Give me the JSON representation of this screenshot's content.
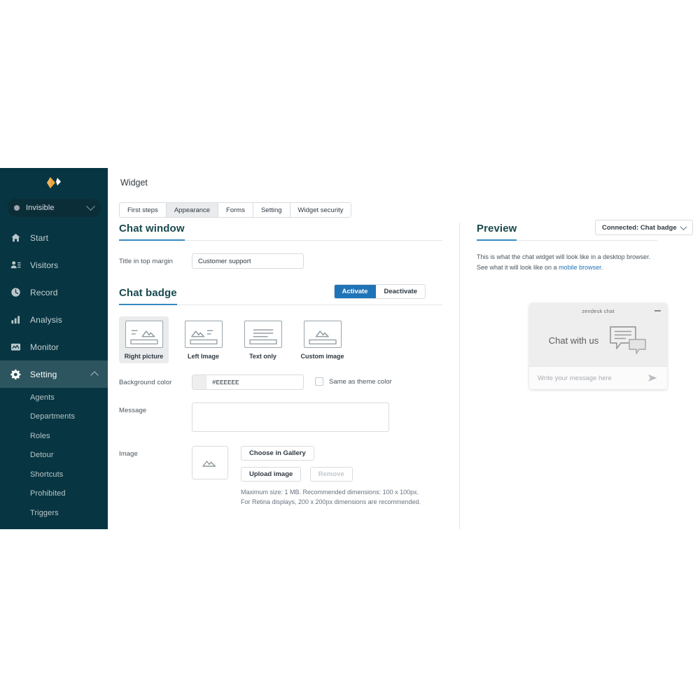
{
  "sidebar": {
    "logo_icon": "diamond-logo-icon",
    "status": {
      "label": "Invisible",
      "icon": "status-dot-icon",
      "chevron": "chevron-down-icon"
    },
    "items": [
      {
        "label": "Start",
        "icon": "home-icon",
        "active": false
      },
      {
        "label": "Visitors",
        "icon": "visitors-icon",
        "active": false
      },
      {
        "label": "Record",
        "icon": "clock-icon",
        "active": false
      },
      {
        "label": "Analysis",
        "icon": "bar-chart-icon",
        "active": false
      },
      {
        "label": "Monitor",
        "icon": "monitor-icon",
        "active": false
      },
      {
        "label": "Setting",
        "icon": "gear-icon",
        "active": true
      }
    ],
    "sub_items": [
      {
        "label": "Agents"
      },
      {
        "label": "Departments"
      },
      {
        "label": "Roles"
      },
      {
        "label": "Detour"
      },
      {
        "label": "Shortcuts"
      },
      {
        "label": "Prohibited"
      },
      {
        "label": "Triggers"
      }
    ]
  },
  "header": {
    "title": "Widget"
  },
  "tabs": [
    {
      "label": "First steps",
      "selected": false
    },
    {
      "label": "Appearance",
      "selected": true
    },
    {
      "label": "Forms",
      "selected": false
    },
    {
      "label": "Setting",
      "selected": false
    },
    {
      "label": "Widget security",
      "selected": false
    }
  ],
  "chat_window": {
    "section_title": "Chat window",
    "title_field": {
      "label": "Title in top margin",
      "value": "Customer support"
    }
  },
  "chat_badge": {
    "section_title": "Chat badge",
    "activate_label": "Activate",
    "deactivate_label": "Deactivate",
    "layouts": [
      {
        "label": "Right picture",
        "icon": "layout-right-picture-icon",
        "selected": true
      },
      {
        "label": "Left Image",
        "icon": "layout-left-image-icon",
        "selected": false
      },
      {
        "label": "Text only",
        "icon": "layout-text-only-icon",
        "selected": false
      },
      {
        "label": "Custom image",
        "icon": "layout-custom-image-icon",
        "selected": false
      }
    ],
    "background_color": {
      "label": "Background color",
      "value": "#EEEEEE",
      "swatch_hex": "#EEEEEE",
      "checkbox_label": "Same as theme color",
      "checkbox_checked": false
    },
    "message": {
      "label": "Message",
      "value": "",
      "placeholder": ""
    },
    "image": {
      "label": "Image",
      "thumb_icon": "image-placeholder-icon",
      "choose_label": "Choose in Gallery",
      "upload_label": "Upload image",
      "remove_label": "Remove",
      "hint_line1": "Maximum size: 1 MB. Recommended dimensions: 100 x 100px.",
      "hint_line2": "For Retina displays, 200 x 200px dimensions are recommended."
    }
  },
  "preview": {
    "title": "Preview",
    "dropdown_value": "Connected: Chat badge",
    "desc_part1": "This is what the chat widget will look like in a desktop browser. See what it will look like on a ",
    "desc_link": "mobile browser",
    "desc_part2": ".",
    "widget": {
      "bar_title": "zendesk chat",
      "minimize_icon": "minimize-icon",
      "message": "Chat with us",
      "badge_icon": "chat-bubbles-icon",
      "input_placeholder": "Write your message here",
      "send_icon": "send-arrow-icon",
      "background_hex": "#EEEEEE"
    }
  },
  "colors": {
    "sidebar_bg": "#073642",
    "sidebar_active": "#2d5560",
    "accent_blue": "#1f73b7",
    "underline_blue": "#3789c4",
    "heading": "#17494d"
  }
}
